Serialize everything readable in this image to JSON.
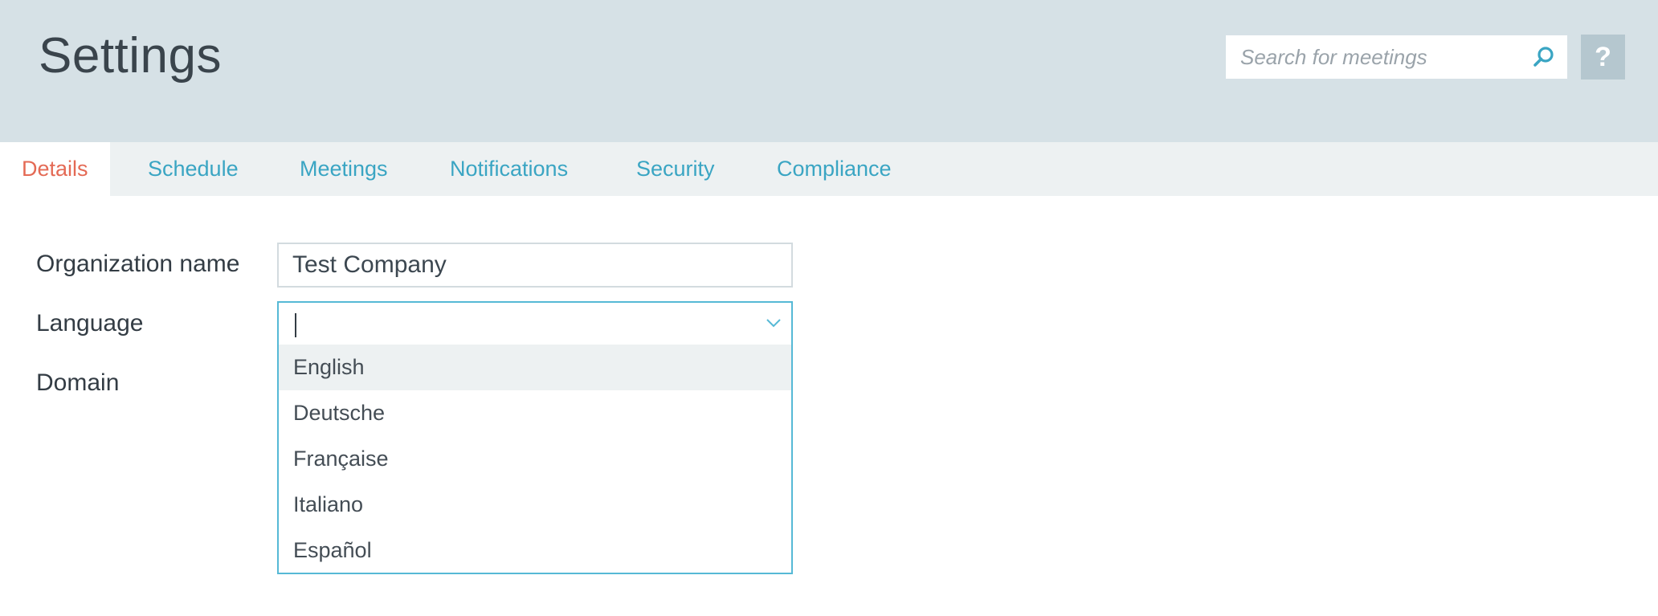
{
  "header": {
    "title": "Settings",
    "search": {
      "placeholder": "Search for meetings",
      "value": ""
    },
    "help_label": "?"
  },
  "tabs": [
    {
      "label": "Details",
      "active": true
    },
    {
      "label": "Schedule",
      "active": false
    },
    {
      "label": "Meetings",
      "active": false
    },
    {
      "label": "Notifications",
      "active": false
    },
    {
      "label": "Security",
      "active": false
    },
    {
      "label": "Compliance",
      "active": false
    }
  ],
  "form": {
    "organization": {
      "label": "Organization name",
      "value": "Test Company"
    },
    "language": {
      "label": "Language",
      "value": "",
      "options": [
        "English",
        "Deutsche",
        "Française",
        "Italiano",
        "Español"
      ],
      "highlighted": "English"
    },
    "domain": {
      "label": "Domain"
    }
  },
  "colors": {
    "header_bg": "#d6e1e6",
    "tab_active": "#e46a55",
    "tab_link": "#3aa5c3",
    "focus_border": "#56b9d6"
  },
  "icons": {
    "search": "search-icon",
    "dropdown": "chevron-down-icon"
  }
}
